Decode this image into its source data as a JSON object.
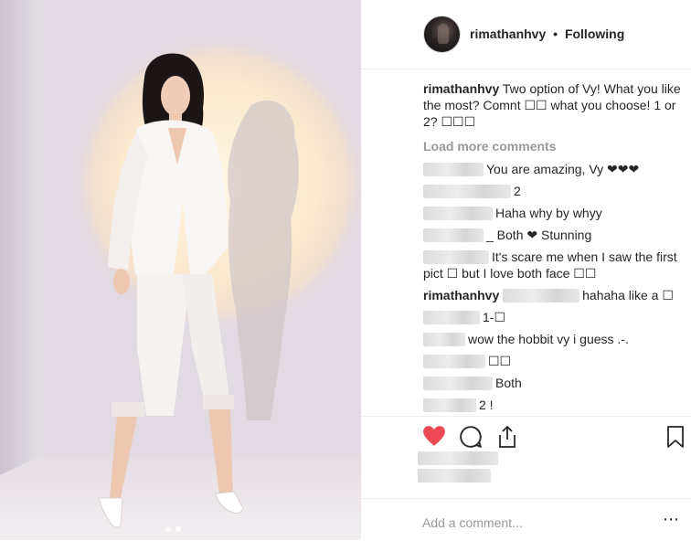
{
  "post": {
    "username": "rimathanhvy",
    "separator": "•",
    "follow_status": "Following",
    "caption_text": " Two option of Vy! What you like the most? Comnt ☐☐ what you choose! 1 or 2? ☐☐☐"
  },
  "comments_section": {
    "load_more": "Load more comments",
    "items": [
      {
        "text": "You are amazing, Vy ❤❤❤"
      },
      {
        "text": "2"
      },
      {
        "text": "Haha why by whyy"
      },
      {
        "text": "_ Both ❤ Stunning"
      },
      {
        "text": "It's scare me when I saw the first pict ☐ but I love both face ☐☐"
      },
      {
        "username": "rimathanhvy",
        "text": "hahaha like a ☐"
      },
      {
        "text": "1-☐"
      },
      {
        "text": "wow the hobbit vy i guess .-."
      },
      {
        "text": "☐☐"
      },
      {
        "text": "Both"
      },
      {
        "text": "2 !"
      }
    ]
  },
  "actions": {
    "like_icon": "heart-icon",
    "comment_icon": "comment-icon",
    "share_icon": "share-icon",
    "save_icon": "bookmark-icon",
    "like_color": "#ed4956"
  },
  "add_comment": {
    "placeholder": "Add a comment...",
    "more_icon": "more-icon"
  },
  "carousel": {
    "slides": 2,
    "active_slide": 2
  }
}
